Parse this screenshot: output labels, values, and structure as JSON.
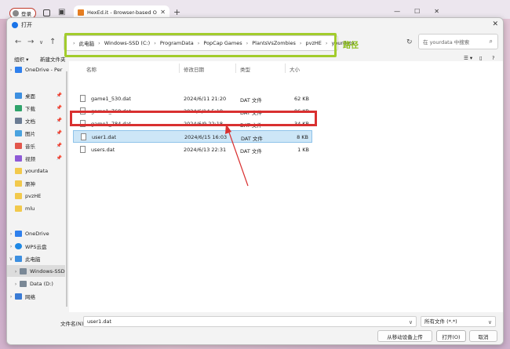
{
  "browser": {
    "login_label": "登录",
    "tab_title": "HexEd.it - Browser-based Online",
    "colors": {
      "tab_favicon": "#e67e22"
    }
  },
  "dialog": {
    "title": "打开",
    "nav": {
      "back": "←",
      "forward": "→",
      "up": "↑"
    },
    "breadcrumb": [
      "此电脑",
      "Windows-SSD (C:)",
      "ProgramData",
      "PopCap Games",
      "PlantsVsZombies",
      "pvzHE",
      "yourdata"
    ],
    "path_annotation": "路径",
    "search_placeholder": "在 yourdata 中搜索",
    "toolbar": {
      "organize": "组织 ▾",
      "new_folder": "新建文件夹"
    },
    "sidebar": [
      {
        "label": "OneDrive - Per",
        "icon": "onedrive-icon",
        "chevron": ">"
      },
      {
        "label": "桌面",
        "icon": "desktop-icon",
        "pinned": true
      },
      {
        "label": "下载",
        "icon": "download-icon",
        "pinned": true
      },
      {
        "label": "文档",
        "icon": "documents-icon",
        "pinned": true
      },
      {
        "label": "图片",
        "icon": "pictures-icon",
        "pinned": true
      },
      {
        "label": "音乐",
        "icon": "music-icon",
        "pinned": true
      },
      {
        "label": "视频",
        "icon": "video-icon",
        "pinned": true
      },
      {
        "label": "yourdata",
        "icon": "folder-icon"
      },
      {
        "label": "原神",
        "icon": "folder-icon"
      },
      {
        "label": "pvzHE",
        "icon": "folder-icon"
      },
      {
        "label": "mlu",
        "icon": "folder-icon"
      },
      {
        "label": "OneDrive",
        "icon": "onedrive-icon",
        "chevron": ">"
      },
      {
        "label": "WPS云盘",
        "icon": "cloud-icon",
        "chevron": ">"
      },
      {
        "label": "此电脑",
        "icon": "pc-icon",
        "chevron": "∨"
      },
      {
        "label": "Windows-SSD",
        "icon": "drive-icon",
        "chevron": ">"
      },
      {
        "label": "Data (D:)",
        "icon": "drive-icon",
        "chevron": ">"
      },
      {
        "label": "网络",
        "icon": "network-icon",
        "chevron": ">"
      }
    ],
    "columns": {
      "name": "名称",
      "modified": "修改日期",
      "type": "类型",
      "size": "大小"
    },
    "files": [
      {
        "name": "game1_530.dat",
        "modified": "2024/6/11 21:20",
        "type": "DAT 文件",
        "size": "62 KB"
      },
      {
        "name": "game1_768.dat",
        "modified": "2024/6/14 5:18",
        "type": "DAT 文件",
        "size": "86 KB"
      },
      {
        "name": "game1_784.dat",
        "modified": "2024/6/9 22:18",
        "type": "DAT 文件",
        "size": "34 KB"
      },
      {
        "name": "user1.dat",
        "modified": "2024/6/15 16:03",
        "type": "DAT 文件",
        "size": "8 KB",
        "selected": true
      },
      {
        "name": "users.dat",
        "modified": "2024/6/13 22:31",
        "type": "DAT 文件",
        "size": "1 KB"
      }
    ],
    "footer": {
      "filename_label": "文件名(N):",
      "filename_value": "user1.dat",
      "filetype_value": "所有文件 (*.*)",
      "upload_button": "从移动设备上传",
      "open_button": "打开(O)",
      "cancel_button": "取消"
    },
    "colors": {
      "path_highlight": "#a2cc2c",
      "selection_box": "#d93030",
      "selected_row": "#cde6f7"
    }
  }
}
